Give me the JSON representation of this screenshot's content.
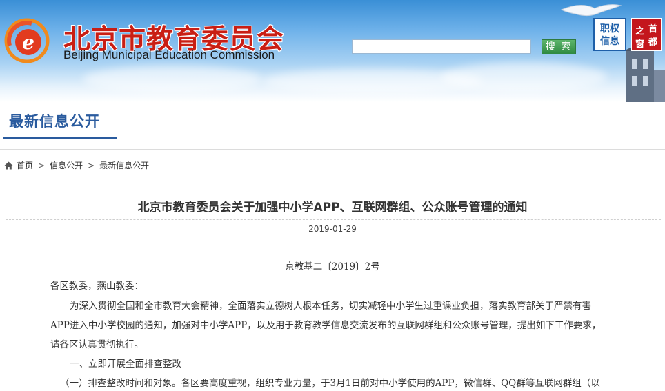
{
  "header": {
    "site_title_cn": "北京市教育委员会",
    "site_title_en": "Beijing Municipal Education Commission",
    "search": {
      "placeholder": "",
      "value": "",
      "button_label": "搜 索"
    },
    "badge_zhiquan": {
      "line1": "职权",
      "line2": "信息"
    },
    "badge_shoudu": {
      "chars": [
        "首",
        "都",
        "之",
        "窗"
      ]
    }
  },
  "section": {
    "title": "最新信息公开"
  },
  "breadcrumb": {
    "items": [
      "首页",
      "信息公开",
      "最新信息公开"
    ],
    "separator": ">"
  },
  "article": {
    "title": "北京市教育委员会关于加强中小学APP、互联网群组、公众账号管理的通知",
    "date": "2019-01-29",
    "doc_number": "京教基二〔2019〕2号",
    "lines": [
      "各区教委，燕山教委：",
      "为深入贯彻全国和全市教育大会精神，全面落实立德树人根本任务，切实减轻中小学生过重课业负担，落实教育部关于严禁有害",
      "APP进入中小学校园的通知，加强对中小学APP，以及用于教育教学信息交流发布的互联网群组和公众账号管理，提出如下工作要求，",
      "请各区认真贯彻执行。",
      "一、立即开展全面排查整改",
      "（一）排查整改时间和对象。各区要高度重视，组织专业力量，于3月1日前对中小学使用的APP，微信群、QQ群等互联网群组（以"
    ]
  },
  "colors": {
    "title_red": "#c91e14",
    "section_blue": "#2a5b9e",
    "search_green": "#3a9a4c",
    "badge_red": "#c4161c"
  }
}
